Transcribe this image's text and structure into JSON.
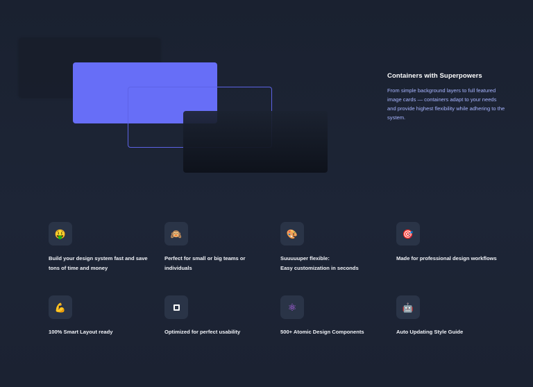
{
  "hero": {
    "title": "Containers with Superpowers",
    "description": "From simple background layers to full featured image cards — containers adapt to your needs and provide highest flexibility while adhering to the system."
  },
  "colors": {
    "background": "#1b2232",
    "accent": "#676ef7",
    "accent_text": "#a7b4ff",
    "icon_tile": "#2a3447"
  },
  "features": [
    {
      "icon": "money-mouth-face-icon",
      "glyph": "🤑",
      "label": "Build your design system fast and save tons of time and money"
    },
    {
      "icon": "team-face-icon",
      "glyph": "🙉",
      "label": "Perfect for small or big teams or individuals"
    },
    {
      "icon": "palette-icon",
      "glyph": "🎨",
      "label": "Suuuuuper flexible:\nEasy customization in seconds"
    },
    {
      "icon": "target-icon",
      "glyph": "🎯",
      "label": "Made for professional design workflows"
    },
    {
      "icon": "flexed-biceps-icon",
      "glyph": "💪",
      "label": "100% Smart Layout ready"
    },
    {
      "icon": "square-icon",
      "glyph": "",
      "label": "Optimized for perfect usability"
    },
    {
      "icon": "atom-symbol-icon",
      "glyph": "⚛",
      "label": "500+ Atomic Design Components"
    },
    {
      "icon": "robot-icon",
      "glyph": "🤖",
      "label": "Auto Updating Style Guide"
    }
  ]
}
